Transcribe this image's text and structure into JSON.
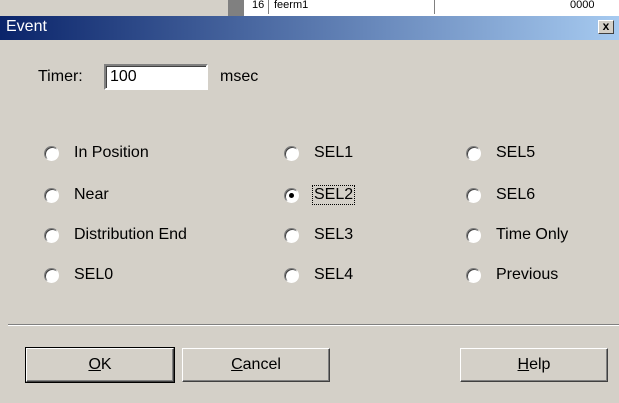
{
  "window": {
    "title": "Event",
    "close_label": "x"
  },
  "timer": {
    "label": "Timer:",
    "value": "100",
    "unit": "msec"
  },
  "radios": [
    {
      "label": "In Position",
      "checked": false
    },
    {
      "label": "Near",
      "checked": false
    },
    {
      "label": "Distribution End",
      "checked": false
    },
    {
      "label": "SEL0",
      "checked": false
    },
    {
      "label": "SEL1",
      "checked": false
    },
    {
      "label": "SEL2",
      "checked": true
    },
    {
      "label": "SEL3",
      "checked": false
    },
    {
      "label": "SEL4",
      "checked": false
    },
    {
      "label": "SEL5",
      "checked": false
    },
    {
      "label": "SEL6",
      "checked": false
    },
    {
      "label": "Time Only",
      "checked": false
    },
    {
      "label": "Previous",
      "checked": false
    }
  ],
  "buttons": {
    "ok": {
      "mnemonic": "O",
      "rest": "K"
    },
    "cancel": {
      "mnemonic": "C",
      "rest": "ancel"
    },
    "help": {
      "mnemonic": "H",
      "rest": "elp"
    }
  },
  "background": {
    "cell1": "16",
    "cell2": "feerm1",
    "cell3": "0000"
  }
}
